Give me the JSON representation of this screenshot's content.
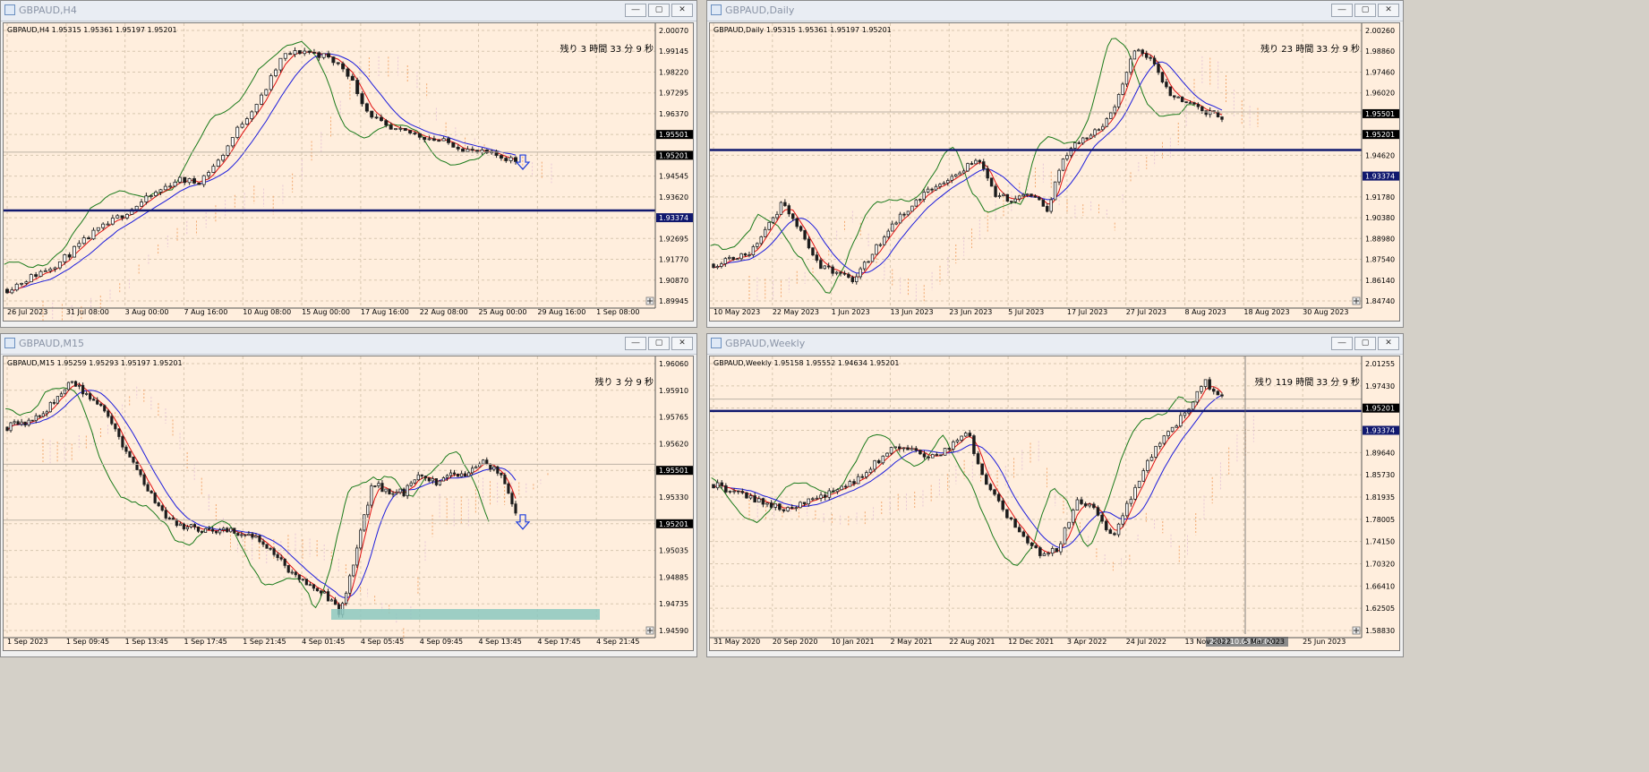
{
  "windows": [
    {
      "id": "h4",
      "title": "GBPAUD,H4",
      "ohlc_line": "GBPAUD,H4  1.95315 1.95361 1.95197 1.95201",
      "remaining": "残り 3 時間 33 分 9 秒",
      "y_ticks": [
        "2.00070",
        "1.99145",
        "1.98220",
        "1.97295",
        "1.96370",
        "1.95501",
        "1.95201",
        "1.94545",
        "1.93620",
        "1.93374",
        "1.92695",
        "1.91770",
        "1.90870",
        "1.89945"
      ],
      "x_ticks": [
        "26 Jul 2023",
        "31 Jul 08:00",
        "3 Aug 00:00",
        "7 Aug 16:00",
        "10 Aug 08:00",
        "15 Aug 00:00",
        "17 Aug 16:00",
        "22 Aug 08:00",
        "25 Aug 00:00",
        "29 Aug 16:00",
        "1 Sep 08:00"
      ]
    },
    {
      "id": "daily",
      "title": "GBPAUD,Daily",
      "ohlc_line": "GBPAUD,Daily  1.95315 1.95361 1.95197 1.95201",
      "remaining": "残り 23 時間 33 分 9 秒",
      "y_ticks": [
        "2.00260",
        "1.98860",
        "1.97460",
        "1.96020",
        "1.95501",
        "1.95201",
        "1.94620",
        "1.93374",
        "1.91780",
        "1.90380",
        "1.88980",
        "1.87540",
        "1.86140",
        "1.84740"
      ],
      "x_ticks": [
        "10 May 2023",
        "22 May 2023",
        "1 Jun 2023",
        "13 Jun 2023",
        "23 Jun 2023",
        "5 Jul 2023",
        "17 Jul 2023",
        "27 Jul 2023",
        "8 Aug 2023",
        "18 Aug 2023",
        "30 Aug 2023"
      ]
    },
    {
      "id": "m15",
      "title": "GBPAUD,M15",
      "ohlc_line": "GBPAUD,M15  1.95259 1.95293 1.95197 1.95201",
      "remaining": "残り 3 分 9 秒",
      "y_ticks": [
        "1.96060",
        "1.95910",
        "1.95765",
        "1.95620",
        "1.95501",
        "1.95330",
        "1.95201",
        "1.95035",
        "1.94885",
        "1.94735",
        "1.94590"
      ],
      "x_ticks": [
        "1 Sep 2023",
        "1 Sep 09:45",
        "1 Sep 13:45",
        "1 Sep 17:45",
        "1 Sep 21:45",
        "4 Sep 01:45",
        "4 Sep 05:45",
        "4 Sep 09:45",
        "4 Sep 13:45",
        "4 Sep 17:45",
        "4 Sep 21:45"
      ]
    },
    {
      "id": "weekly",
      "title": "GBPAUD,Weekly",
      "ohlc_line": "GBPAUD,Weekly  1.95158 1.95552 1.94634 1.95201",
      "remaining": "残り 119 時間 33 分 9 秒",
      "y_ticks": [
        "2.01255",
        "1.97430",
        "1.95201",
        "1.93374",
        "1.89640",
        "1.85730",
        "1.81935",
        "1.78005",
        "1.74150",
        "1.70320",
        "1.66410",
        "1.62505",
        "1.58830"
      ],
      "x_ticks": [
        "31 May 2020",
        "20 Sep 2020",
        "10 Jan 2021",
        "2 May 2021",
        "22 Aug 2021",
        "12 Dec 2021",
        "3 Apr 2022",
        "24 Jul 2022",
        "13 Nov 2022",
        "5 Mar 2023",
        "25 Jun 2023"
      ],
      "cursor_label": "2023.10.08 00:00"
    }
  ],
  "chart_data": [
    {
      "type": "candlestick",
      "symbol": "GBPAUD",
      "timeframe": "H4",
      "ylim": [
        1.89945,
        2.0007
      ],
      "current_price": 1.95201,
      "marked_levels": [
        1.95501,
        1.93374
      ],
      "x_labels": [
        "26 Jul 2023",
        "31 Jul 08:00",
        "3 Aug 00:00",
        "7 Aug 16:00",
        "10 Aug 08:00",
        "15 Aug 00:00",
        "17 Aug 16:00",
        "22 Aug 08:00",
        "25 Aug 00:00",
        "29 Aug 16:00",
        "1 Sep 08:00"
      ],
      "close_path": [
        [
          0,
          1.905
        ],
        [
          5,
          1.915
        ],
        [
          8,
          1.925
        ],
        [
          10,
          1.93
        ],
        [
          12,
          1.935
        ],
        [
          14,
          1.94
        ],
        [
          16,
          1.945
        ],
        [
          18,
          1.944
        ],
        [
          20,
          1.952
        ],
        [
          22,
          1.965
        ],
        [
          24,
          1.975
        ],
        [
          26,
          1.99
        ],
        [
          28,
          1.992
        ],
        [
          30,
          1.99
        ],
        [
          32,
          1.985
        ],
        [
          34,
          1.97
        ],
        [
          36,
          1.963
        ],
        [
          38,
          1.962
        ],
        [
          40,
          1.96
        ],
        [
          42,
          1.958
        ],
        [
          44,
          1.955
        ],
        [
          46,
          1.954
        ],
        [
          48,
          1.952
        ]
      ]
    },
    {
      "type": "candlestick",
      "symbol": "GBPAUD",
      "timeframe": "Daily",
      "ylim": [
        1.8474,
        2.0026
      ],
      "current_price": 1.95201,
      "marked_levels": [
        1.95501,
        1.93374
      ],
      "x_labels": [
        "10 May 2023",
        "22 May 2023",
        "1 Jun 2023",
        "13 Jun 2023",
        "23 Jun 2023",
        "5 Jul 2023",
        "17 Jul 2023",
        "27 Jul 2023",
        "8 Aug 2023",
        "18 Aug 2023",
        "30 Aug 2023"
      ],
      "close_path": [
        [
          0,
          1.87
        ],
        [
          4,
          1.875
        ],
        [
          8,
          1.905
        ],
        [
          12,
          1.87
        ],
        [
          16,
          1.86
        ],
        [
          20,
          1.89
        ],
        [
          24,
          1.91
        ],
        [
          28,
          1.92
        ],
        [
          30,
          1.93
        ],
        [
          32,
          1.91
        ],
        [
          34,
          1.905
        ],
        [
          36,
          1.91
        ],
        [
          38,
          1.9
        ],
        [
          40,
          1.93
        ],
        [
          42,
          1.94
        ],
        [
          44,
          1.945
        ],
        [
          46,
          1.96
        ],
        [
          48,
          1.99
        ],
        [
          50,
          1.985
        ],
        [
          52,
          1.965
        ],
        [
          54,
          1.96
        ],
        [
          56,
          1.955
        ],
        [
          58,
          1.952
        ]
      ]
    },
    {
      "type": "candlestick",
      "symbol": "GBPAUD",
      "timeframe": "M15",
      "ylim": [
        1.9459,
        1.9606
      ],
      "current_price": 1.95201,
      "marked_levels": [
        1.95501,
        1.95201
      ],
      "x_labels": [
        "1 Sep 2023",
        "1 Sep 09:45",
        "1 Sep 13:45",
        "1 Sep 17:45",
        "1 Sep 21:45",
        "4 Sep 01:45",
        "4 Sep 05:45",
        "4 Sep 09:45",
        "4 Sep 13:45",
        "4 Sep 17:45",
        "4 Sep 21:45"
      ],
      "close_path": [
        [
          0,
          1.957
        ],
        [
          4,
          1.9575
        ],
        [
          8,
          1.9595
        ],
        [
          12,
          1.958
        ],
        [
          16,
          1.955
        ],
        [
          20,
          1.952
        ],
        [
          24,
          1.9515
        ],
        [
          28,
          1.9515
        ],
        [
          32,
          1.951
        ],
        [
          36,
          1.949
        ],
        [
          40,
          1.948
        ],
        [
          42,
          1.947
        ],
        [
          44,
          1.9505
        ],
        [
          46,
          1.954
        ],
        [
          48,
          1.9535
        ],
        [
          50,
          1.9535
        ],
        [
          52,
          1.9545
        ],
        [
          54,
          1.954
        ],
        [
          56,
          1.9545
        ],
        [
          58,
          1.9545
        ],
        [
          60,
          1.9552
        ],
        [
          62,
          1.9545
        ],
        [
          64,
          1.9525
        ]
      ]
    },
    {
      "type": "candlestick",
      "symbol": "GBPAUD",
      "timeframe": "Weekly",
      "ylim": [
        1.5883,
        2.01255
      ],
      "current_price": 1.95201,
      "marked_levels": [
        1.95201,
        1.93374
      ],
      "x_labels": [
        "31 May 2020",
        "20 Sep 2020",
        "10 Jan 2021",
        "2 May 2021",
        "22 Aug 2021",
        "12 Dec 2021",
        "3 Apr 2022",
        "24 Jul 2022",
        "13 Nov 2022",
        "5 Mar 2023",
        "25 Jun 2023"
      ],
      "close_path": [
        [
          0,
          1.82
        ],
        [
          4,
          1.8
        ],
        [
          8,
          1.78
        ],
        [
          12,
          1.8
        ],
        [
          16,
          1.83
        ],
        [
          20,
          1.88
        ],
        [
          24,
          1.86
        ],
        [
          28,
          1.9
        ],
        [
          30,
          1.82
        ],
        [
          32,
          1.78
        ],
        [
          34,
          1.74
        ],
        [
          36,
          1.71
        ],
        [
          38,
          1.72
        ],
        [
          40,
          1.8
        ],
        [
          42,
          1.78
        ],
        [
          44,
          1.74
        ],
        [
          46,
          1.8
        ],
        [
          48,
          1.86
        ],
        [
          50,
          1.9
        ],
        [
          52,
          1.93
        ],
        [
          54,
          1.98
        ],
        [
          56,
          1.952
        ]
      ]
    }
  ]
}
